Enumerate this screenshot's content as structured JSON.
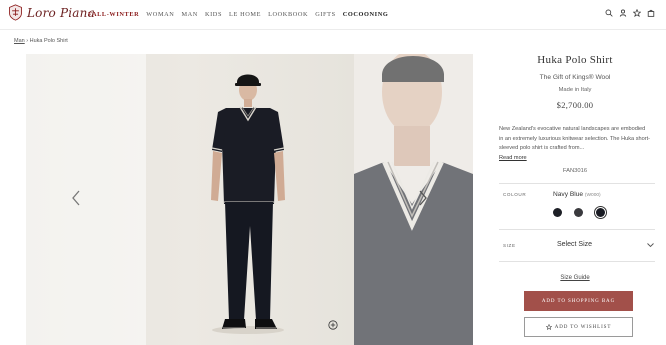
{
  "brand": {
    "name": "Loro Piana"
  },
  "nav": {
    "items": [
      {
        "label": "Fall-Winter",
        "style": "active"
      },
      {
        "label": "Woman",
        "style": ""
      },
      {
        "label": "Man",
        "style": ""
      },
      {
        "label": "Kids",
        "style": ""
      },
      {
        "label": "Le Home",
        "style": ""
      },
      {
        "label": "Lookbook",
        "style": ""
      },
      {
        "label": "Gifts",
        "style": ""
      },
      {
        "label": "Cocooning",
        "style": "black"
      }
    ]
  },
  "header_icons": [
    "search-icon",
    "account-icon",
    "wishlist-star-icon",
    "shopping-bag-icon"
  ],
  "breadcrumb": {
    "parent": "Man",
    "separator": " › ",
    "current": "Huka Polo Shirt"
  },
  "product": {
    "title": "Huka Polo Shirt",
    "subtitle": "The Gift of Kings® Wool",
    "origin": "Made in Italy",
    "price": "$2,700.00",
    "description": "New Zealand's evocative natural landscapes are embodied in an extremely luxurious knitwear selection. The Huka short-sleeved polo shirt is crafted from...",
    "read_more": "Read more",
    "sku": "FAN3016"
  },
  "colour": {
    "label": "Colour",
    "name": "Navy Blue",
    "code": "(W000)",
    "swatches": [
      {
        "color": "#1d1f26",
        "selected": false
      },
      {
        "color": "#3a3a3e",
        "selected": false
      },
      {
        "color": "#181a22",
        "selected": true
      }
    ]
  },
  "size": {
    "label": "Size",
    "value": "Select Size"
  },
  "size_guide": "Size Guide",
  "buttons": {
    "add_to_bag": "Add to Shopping Bag",
    "add_to_wishlist": "Add to Wishlist"
  },
  "colors": {
    "brand": "#8b1a1a",
    "primary_button": "#a2504a"
  }
}
